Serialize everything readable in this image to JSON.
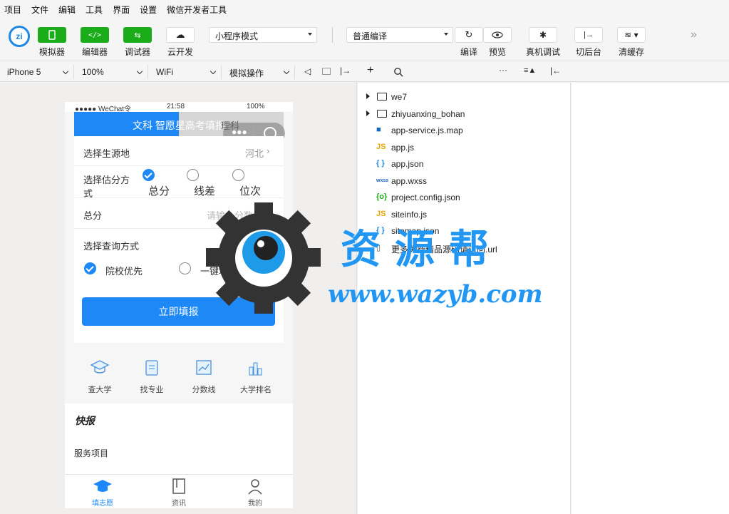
{
  "menu": [
    "项目",
    "文件",
    "编辑",
    "工具",
    "界面",
    "设置",
    "微信开发者工具"
  ],
  "toolbar": {
    "simulator_label": "模拟器",
    "editor_label": "编辑器",
    "debugger_label": "调试器",
    "cloud_label": "云开发",
    "mode_select": "小程序模式",
    "compile_select": "普通编译",
    "compile_label": "编译",
    "preview_label": "预览",
    "realdebug_label": "真机调试",
    "background_label": "切后台",
    "clearcache_label": "清缓存"
  },
  "subbar": {
    "device": "iPhone 5",
    "zoom": "100%",
    "network": "WiFi",
    "operation": "模拟操作"
  },
  "file_tree": [
    {
      "type": "folder",
      "name": "we7",
      "icon": "folder-icon"
    },
    {
      "type": "folder",
      "name": "zhiyuanxing_bohan",
      "icon": "folder-icon"
    },
    {
      "type": "file",
      "name": "app-service.js.map",
      "icon": "map-file-icon",
      "badge": "■",
      "color": "#1565c0"
    },
    {
      "type": "file",
      "name": "app.js",
      "icon": "js-file-icon",
      "badge": "JS",
      "color": "#e6a700"
    },
    {
      "type": "file",
      "name": "app.json",
      "icon": "json-file-icon",
      "badge": "{ }",
      "color": "#1e88e5"
    },
    {
      "type": "file",
      "name": "app.wxss",
      "icon": "wxss-file-icon",
      "badge": "wxss",
      "color": "#1565c0"
    },
    {
      "type": "file",
      "name": "project.config.json",
      "icon": "config-file-icon",
      "badge": "{o}",
      "color": "#1aad19"
    },
    {
      "type": "file",
      "name": "siteinfo.js",
      "icon": "js-file-icon",
      "badge": "JS",
      "color": "#e6a700"
    },
    {
      "type": "file",
      "name": "sitemap.json",
      "icon": "json-file-icon",
      "badge": "{ }",
      "color": "#1e88e5"
    },
    {
      "type": "file",
      "name": "更多免费精品源码请访问.url",
      "icon": "file-icon",
      "badge": "▯",
      "color": "#555"
    }
  ],
  "phone": {
    "status_left": "●●●●● WeChat令",
    "status_time": "21:58",
    "status_right": "100%",
    "header_title": "文科 智愿星高考填报",
    "header_right": "理科",
    "form": {
      "origin_label": "选择生源地",
      "origin_value": "河北",
      "estimate_label": "选择估分方式",
      "estimate_options": [
        "总分",
        "线差",
        "位次"
      ],
      "score_label": "总分",
      "score_placeholder": "请输入分数",
      "query_label": "选择查询方式",
      "query_options": [
        "院校优先",
        "一键填报"
      ],
      "submit_label": "立即填报"
    },
    "nav": [
      "查大学",
      "找专业",
      "分数线",
      "大学排名"
    ],
    "news_title": "快报",
    "service_title": "服务项目",
    "tabs": [
      "填志愿",
      "资讯",
      "我的"
    ]
  },
  "watermark": {
    "title": "资源帮",
    "url": "www.wazyb.com"
  },
  "colors": {
    "primary": "#1e88f7",
    "green": "#1aad19",
    "watermark_blue": "#2196f3"
  }
}
